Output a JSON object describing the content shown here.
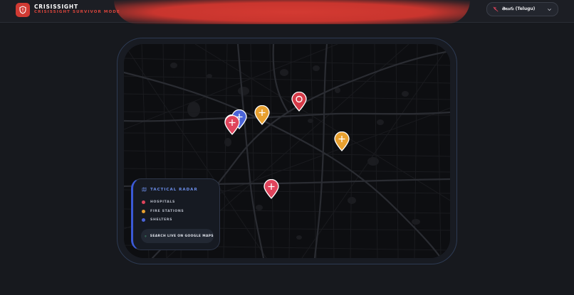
{
  "header": {
    "title": "CRISISSIGHT",
    "subtitle": "CRISISSIGHT SURVIVOR MODE",
    "logo_icon": "shield-icon",
    "language": {
      "selected": "తెలుగు (Telugu)",
      "icon": "translate-off-icon",
      "chevron": "chevron-down-icon"
    }
  },
  "colors": {
    "accent_red": "#d03a33",
    "hospital": "#e0445c",
    "fire_station": "#e8a02f",
    "shelter": "#4a64d8",
    "radar_title": "#6b8de8"
  },
  "map": {
    "markers": [
      {
        "type": "hospital",
        "icon": "cross-icon"
      },
      {
        "type": "shelter",
        "icon": "cross-icon"
      },
      {
        "type": "fire_station",
        "icon": "cross-icon"
      },
      {
        "type": "location",
        "icon": "target-circle-icon"
      },
      {
        "type": "fire_station",
        "icon": "cross-icon"
      },
      {
        "type": "hospital",
        "icon": "cross-icon"
      }
    ]
  },
  "legend": {
    "title": "TACTICAL RADAR",
    "title_icon": "map-icon",
    "items": [
      {
        "label": "HOSPITALS",
        "color": "#e0445c"
      },
      {
        "label": "FIRE STATIONS",
        "color": "#e8a02f"
      },
      {
        "label": "SHELTERS",
        "color": "#4a64d8"
      }
    ],
    "search_button": {
      "label": "SEARCH LIVE ON GOOGLE MAPS",
      "icon": "map-pin-icon"
    }
  }
}
